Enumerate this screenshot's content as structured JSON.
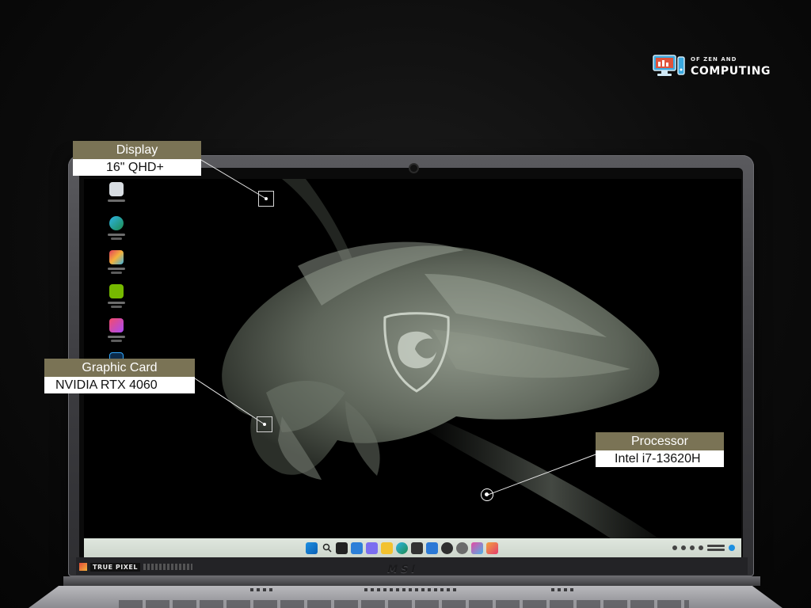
{
  "brand": {
    "small": "OF ZEN AND",
    "big": "COMPUTING"
  },
  "callouts": {
    "display": {
      "title": "Display",
      "value": "16\" QHD+"
    },
    "graphic_card": {
      "title": "Graphic Card",
      "value": "NVIDIA RTX 4060"
    },
    "processor": {
      "title": "Processor",
      "value": "Intel i7-13620H"
    }
  },
  "laptop": {
    "bezel_badge": "TRUE PIXEL",
    "lid_brand": "MSI"
  },
  "colors": {
    "callout_header": "#7a7355",
    "callout_value_bg": "#ffffff",
    "taskbar": "#d6ded5",
    "brand_accent": "#3aa9e0"
  },
  "icons": {
    "desktop": [
      "recycle-bin-icon",
      "edge-icon",
      "msi-true-color-icon",
      "nvidia-icon",
      "adobe-creative-cloud-icon",
      "lightroom-classic-icon"
    ],
    "taskbar": [
      "windows-start-icon",
      "search-icon",
      "task-view-icon",
      "widgets-icon",
      "chat-icon",
      "file-explorer-icon",
      "edge-icon",
      "store-icon",
      "mail-icon",
      "xbox-icon",
      "settings-icon",
      "photos-icon",
      "paint-icon"
    ]
  }
}
